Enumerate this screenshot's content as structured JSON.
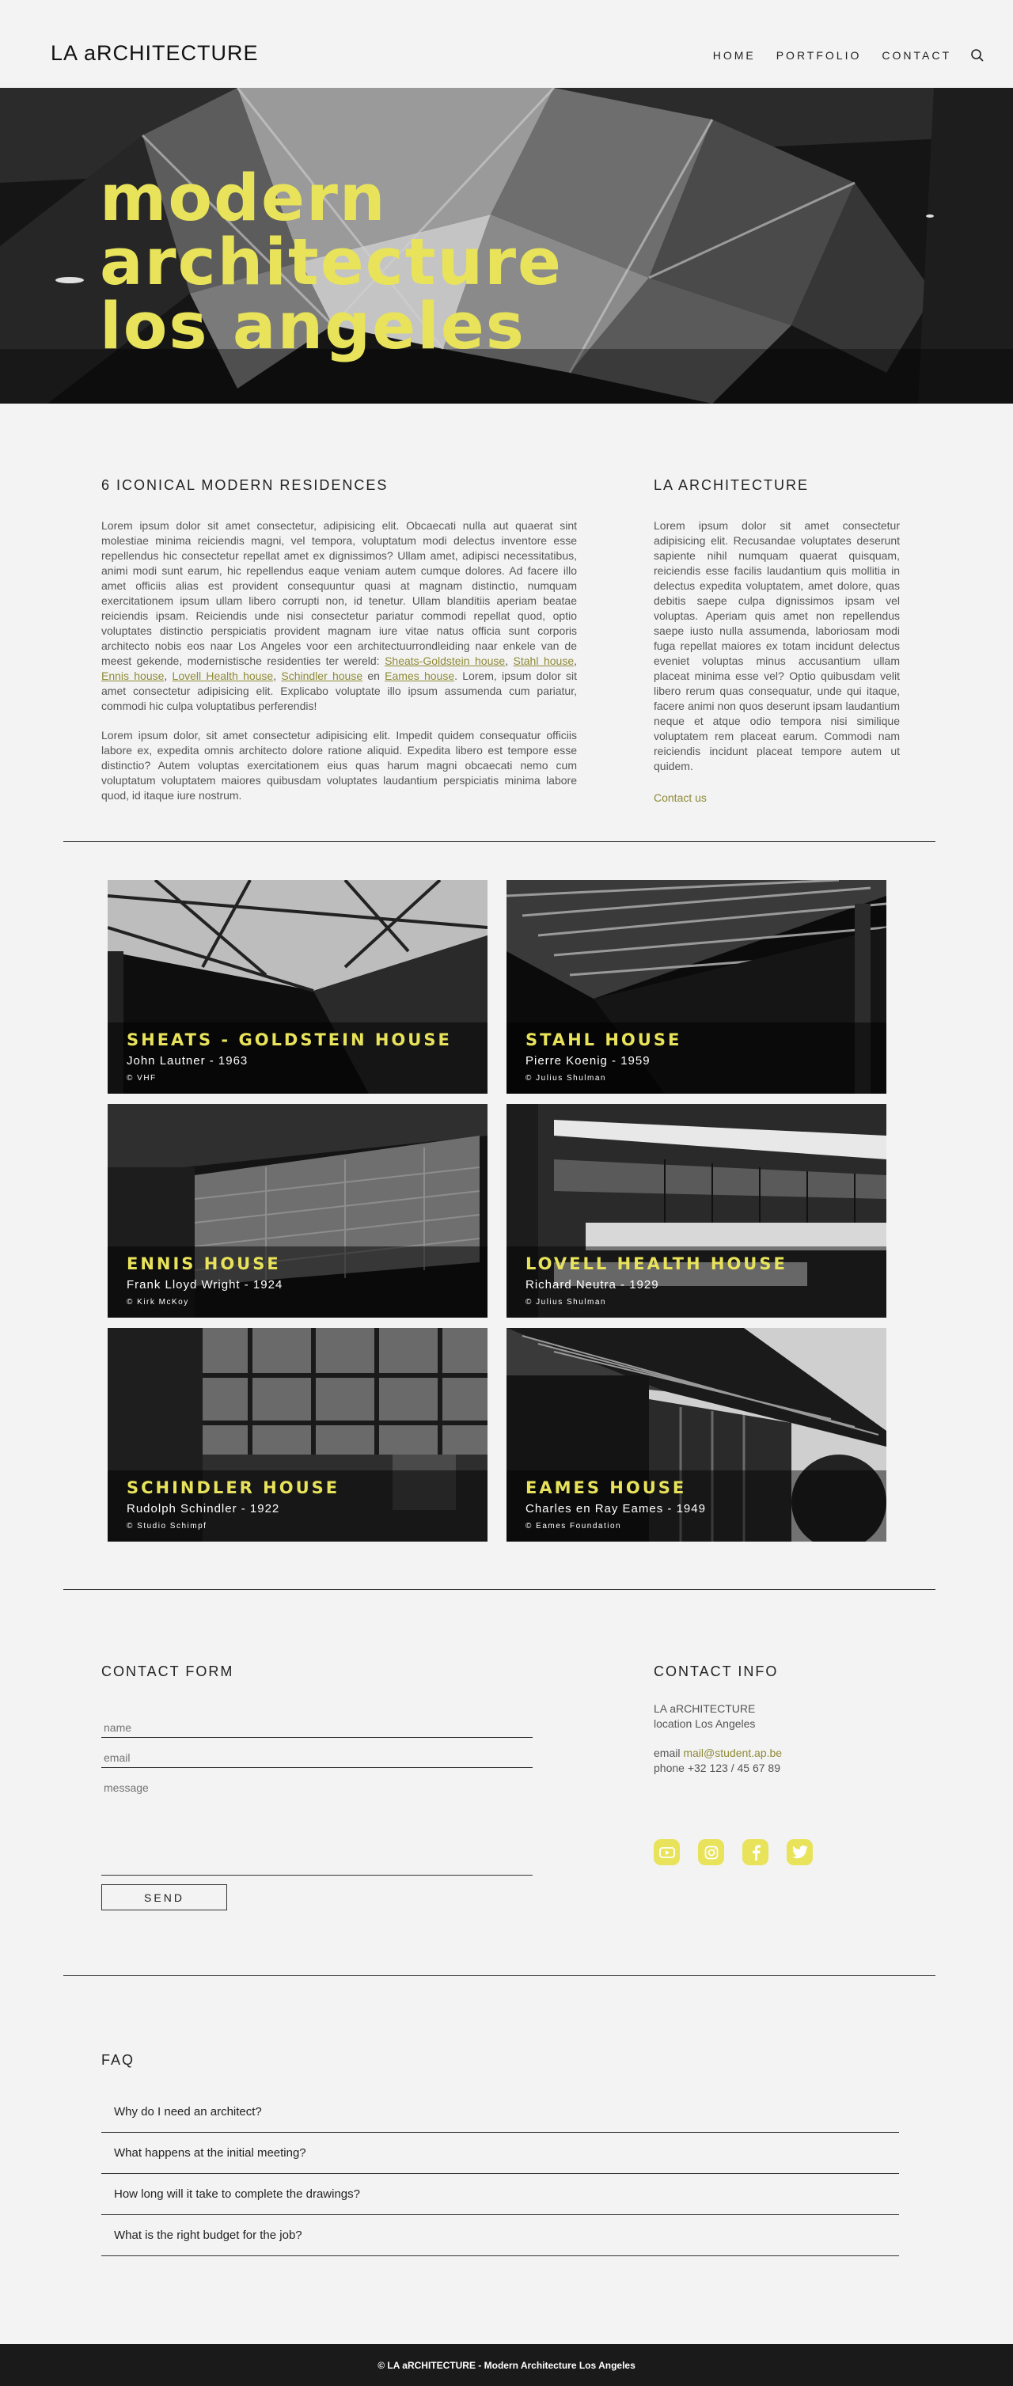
{
  "header": {
    "logo": "LA aRCHITECTURE",
    "nav": [
      "HOME",
      "PORTFOLIO",
      "CONTACT"
    ]
  },
  "hero": {
    "lines": [
      "modern",
      "architecture",
      "los angeles"
    ]
  },
  "intro": {
    "title": "6 ICONICAL MODERN RESIDENCES",
    "para1_text": "Lorem ipsum dolor sit amet consectetur, adipisicing elit. Obcaecati nulla aut quaerat sint molestiae minima reiciendis magni, vel tempora, voluptatum modi delectus inventore esse repellendus hic consectetur repellat amet ex dignissimos? Ullam amet, adipisci necessitatibus, animi modi sunt earum, hic repellendus eaque veniam autem cumque dolores. Ad facere illo amet officiis alias est provident consequuntur quasi at magnam distinctio, numquam exercitationem ipsum ullam libero corrupti non, id tenetur. Ullam blanditiis aperiam beatae reiciendis ipsam. Reiciendis unde nisi consectetur pariatur commodi repellat quod, optio voluptates distinctio perspiciatis provident magnam iure vitae natus officia sunt corporis architecto nobis eos naar Los Angeles voor een architectuurrondleiding naar enkele van de meest gekende, modernistische residenties ter wereld: ",
    "link1": "Sheats-Goldstein house",
    "sep1": ", ",
    "link2": "Stahl house",
    "sep2": ", ",
    "link3": "Ennis house",
    "sep3": ", ",
    "link4": "Lovell Health house",
    "sep4": ", ",
    "link5": "Schindler house",
    "sep5": " en ",
    "link6": "Eames house",
    "para1_end": ". Lorem, ipsum dolor sit amet consectetur adipisicing elit. Explicabo voluptate illo ipsum assumenda cum pariatur, commodi hic culpa voluptatibus perferendis!",
    "para2": "Lorem ipsum dolor, sit amet consectetur adipisicing elit. Impedit quidem consequatur officiis labore ex, expedita omnis architecto dolore ratione aliquid. Expedita libero est tempore esse distinctio? Autem voluptas exercitationem eius quas harum magni obcaecati nemo cum voluptatum voluptatem maiores quibusdam voluptates laudantium perspiciatis minima labore quod, id itaque iure nostrum."
  },
  "about": {
    "title": "LA ARCHITECTURE",
    "text": "Lorem ipsum dolor sit amet consectetur adipisicing elit. Recusandae voluptates deserunt sapiente nihil numquam quaerat quisquam, reiciendis esse facilis laudantium quis mollitia in delectus expedita voluptatem, amet dolore, quas debitis saepe culpa dignissimos ipsam vel voluptas. Aperiam quis amet non repellendus saepe iusto nulla assumenda, laboriosam modi fuga repellat maiores ex totam incidunt delectus eveniet voluptas minus accusantium ullam placeat minima esse vel? Optio quibusdam velit libero rerum quas consequatur, unde qui itaque, facere animi non quos deserunt ipsam laudantium neque et atque odio tempora nisi similique voluptatem rem placeat earum. Commodi nam reiciendis incidunt placeat tempore autem ut quidem.",
    "link": "Contact us"
  },
  "houses": [
    {
      "title": "SHEATS - GOLDSTEIN HOUSE",
      "sub": "John Lautner - 1963",
      "credit": "© VHF"
    },
    {
      "title": "STAHL HOUSE",
      "sub": "Pierre Koenig - 1959",
      "credit": "© Julius Shulman"
    },
    {
      "title": "ENNIS HOUSE",
      "sub": "Frank Lloyd Wright - 1924",
      "credit": "© Kirk McKoy"
    },
    {
      "title": "LOVELL HEALTH HOUSE",
      "sub": "Richard Neutra - 1929",
      "credit": "© Julius Shulman"
    },
    {
      "title": "SCHINDLER HOUSE",
      "sub": "Rudolph Schindler - 1922",
      "credit": "© Studio Schimpf"
    },
    {
      "title": "EAMES HOUSE",
      "sub": "Charles en Ray Eames - 1949",
      "credit": "© Eames Foundation"
    }
  ],
  "contact_form": {
    "title": "CONTACT FORM",
    "name_placeholder": "name",
    "email_placeholder": "email",
    "message_placeholder": "message",
    "send_label": "SEND"
  },
  "contact_info": {
    "title": "CONTACT INFO",
    "line1": "LA aRCHITECTURE",
    "line2": "location Los Angeles",
    "email_label": "email ",
    "email": "mail@student.ap.be",
    "phone": "phone +32 123 / 45 67 89",
    "socials": [
      "youtube-icon",
      "instagram-icon",
      "facebook-icon",
      "twitter-icon"
    ]
  },
  "faq": {
    "title": "FAQ",
    "items": [
      "Why do I need an architect?",
      "What happens at the initial meeting?",
      "How long will it take to complete the drawings?",
      "What is the right budget for the job?"
    ]
  },
  "footer": {
    "text": "© LA aRCHITECTURE - Modern Architecture Los Angeles"
  },
  "colors": {
    "accent": "#e8e35a",
    "link": "#8e8a36",
    "dark": "#1a1a1a",
    "background": "#f3f3f3"
  }
}
